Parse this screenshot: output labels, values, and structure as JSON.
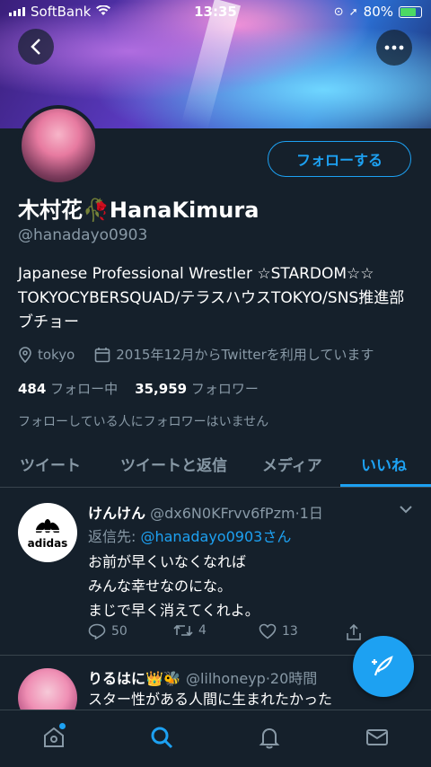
{
  "status_bar": {
    "carrier": "SoftBank",
    "time": "13:35",
    "battery": "80%"
  },
  "profile": {
    "follow_label": "フォローする",
    "name": "木村花🥀HanaKimura",
    "handle": "@hanadayo0903",
    "bio": "Japanese Professional Wrestler ☆STARDOM☆☆ TOKYOCYBERSQUAD/テラスハウスTOKYO/SNS推進部ブチョー",
    "location": "tokyo",
    "joined": "2015年12月からTwitterを利用しています",
    "following_count": "484",
    "following_label": "フォロー中",
    "followers_count": "35,959",
    "followers_label": "フォロワー",
    "no_mutual": "フォローしている人にフォロワーはいません"
  },
  "tabs": [
    {
      "label": "ツイート"
    },
    {
      "label": "ツイートと返信"
    },
    {
      "label": "メディア"
    },
    {
      "label": "いいね"
    }
  ],
  "tweets": [
    {
      "name": "けんけん",
      "handle": "@dx6N0KFrvv6fPzm",
      "time": "·1日",
      "reply_prefix": "返信先: ",
      "reply_to": "@hanadayo0903さん",
      "lines": [
        "お前が早くいなくなれば",
        "みんな幸せなのにな。",
        "まじで早く消えてくれよ。"
      ],
      "replies": "50",
      "retweets": "4",
      "likes": "13",
      "avatar_brand": "adidas"
    },
    {
      "name": "りるはに👑🐝",
      "handle": "@lilhoneyp",
      "time": "·20時間",
      "text": "スター性がある人間に生まれたかった"
    }
  ],
  "colors": {
    "accent": "#1da1f2",
    "background": "#15202b",
    "muted": "#8899a6",
    "divider": "#38444d"
  }
}
